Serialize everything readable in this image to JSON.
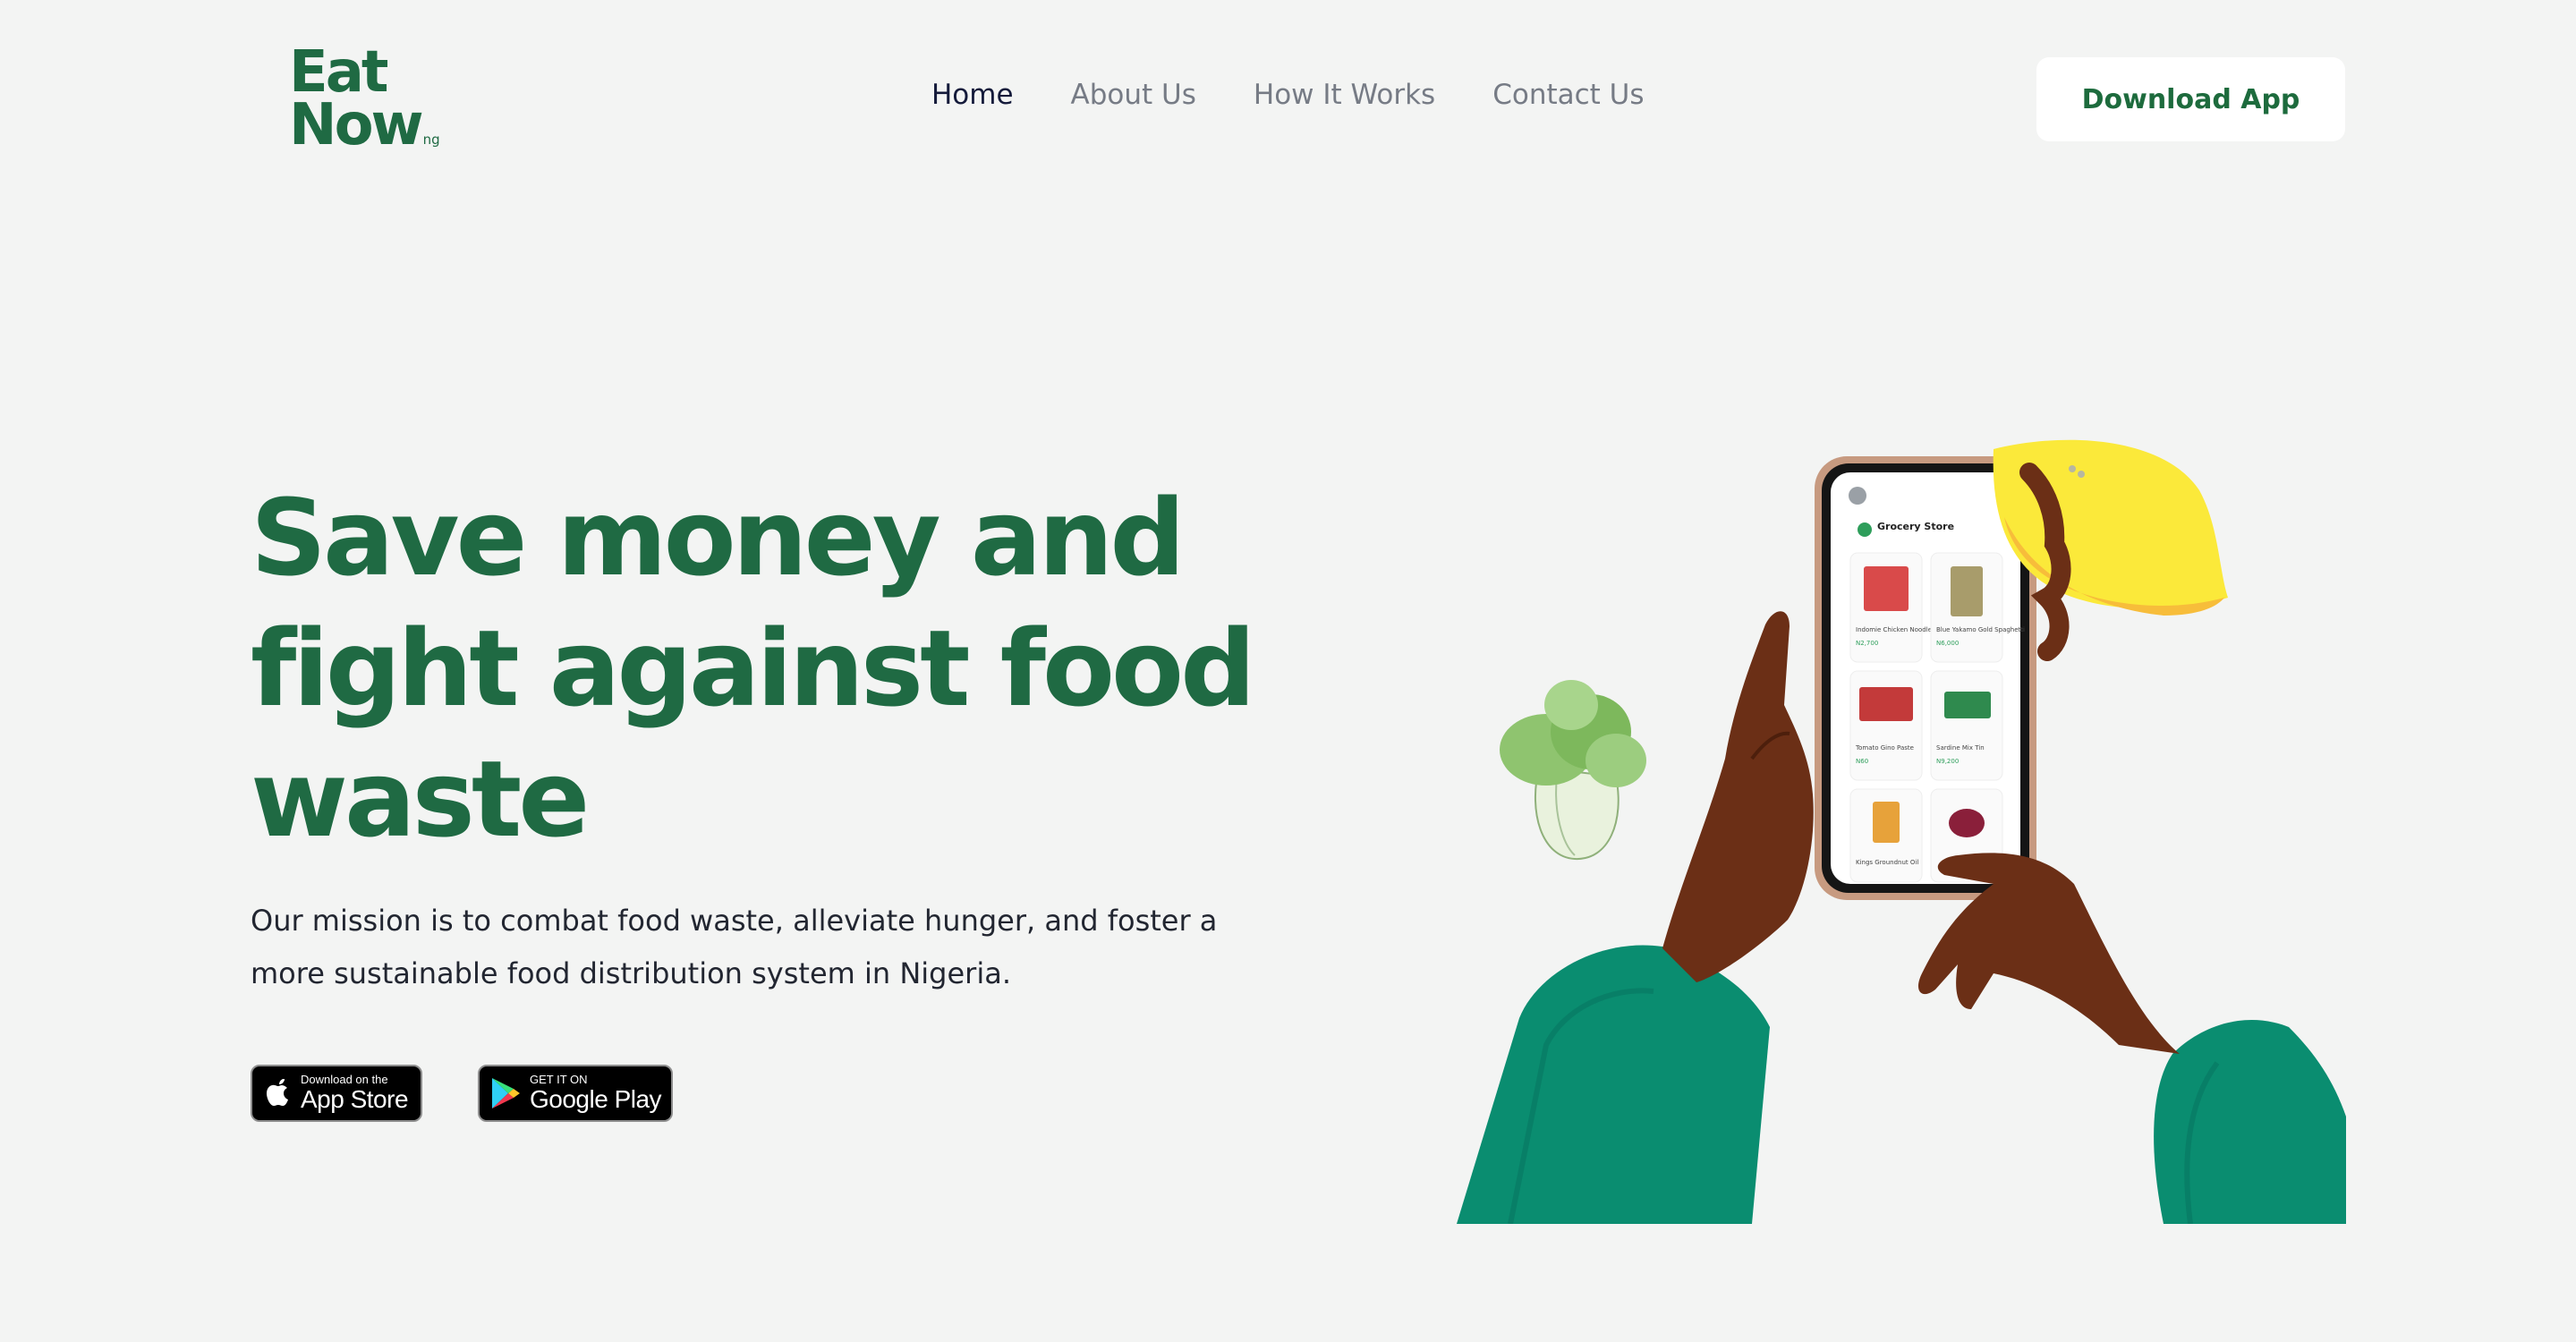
{
  "logo": {
    "line1": "Eat",
    "line2": "Now",
    "suffix": "ng"
  },
  "nav": {
    "items": [
      {
        "label": "Home",
        "active": true
      },
      {
        "label": "About Us",
        "active": false
      },
      {
        "label": "How It Works",
        "active": false
      },
      {
        "label": "Contact Us",
        "active": false
      }
    ]
  },
  "header": {
    "download_label": "Download App"
  },
  "hero": {
    "headline_line1": "Save money and",
    "headline_line2": "fight against food",
    "headline_line3": "waste",
    "mission_line1": "Our mission is to combat food waste, alleviate hunger, and foster a",
    "mission_line2": "more sustainable food distribution system in Nigeria."
  },
  "badges": {
    "appstore_small": "Download on the",
    "appstore_big": "App Store",
    "googleplay_small": "GET IT ON",
    "googleplay_big": "Google Play"
  },
  "phone_screen": {
    "store_title": "Grocery Store",
    "products": [
      {
        "name": "Indomie Chicken Noodles",
        "price": "N2,700"
      },
      {
        "name": "Blue Yakamo Gold Spaghetti",
        "price": "N6,000"
      },
      {
        "name": "Tomato Gino Paste",
        "price": "N60"
      },
      {
        "name": "Sardine Mix Tin",
        "price": "N9,200"
      },
      {
        "name": "Kings Groundnut Oil",
        "price": ""
      },
      {
        "name": "",
        "price": ""
      }
    ]
  },
  "colors": {
    "brand_green": "#1f6a43",
    "background": "#f3f4f3",
    "sleeve": "#0a8d70",
    "skin": "#6b2f16",
    "lemon": "#fbe93a"
  },
  "icons": [
    "apple-icon",
    "google-play-icon",
    "user-avatar-icon",
    "grocery-store-icon"
  ]
}
